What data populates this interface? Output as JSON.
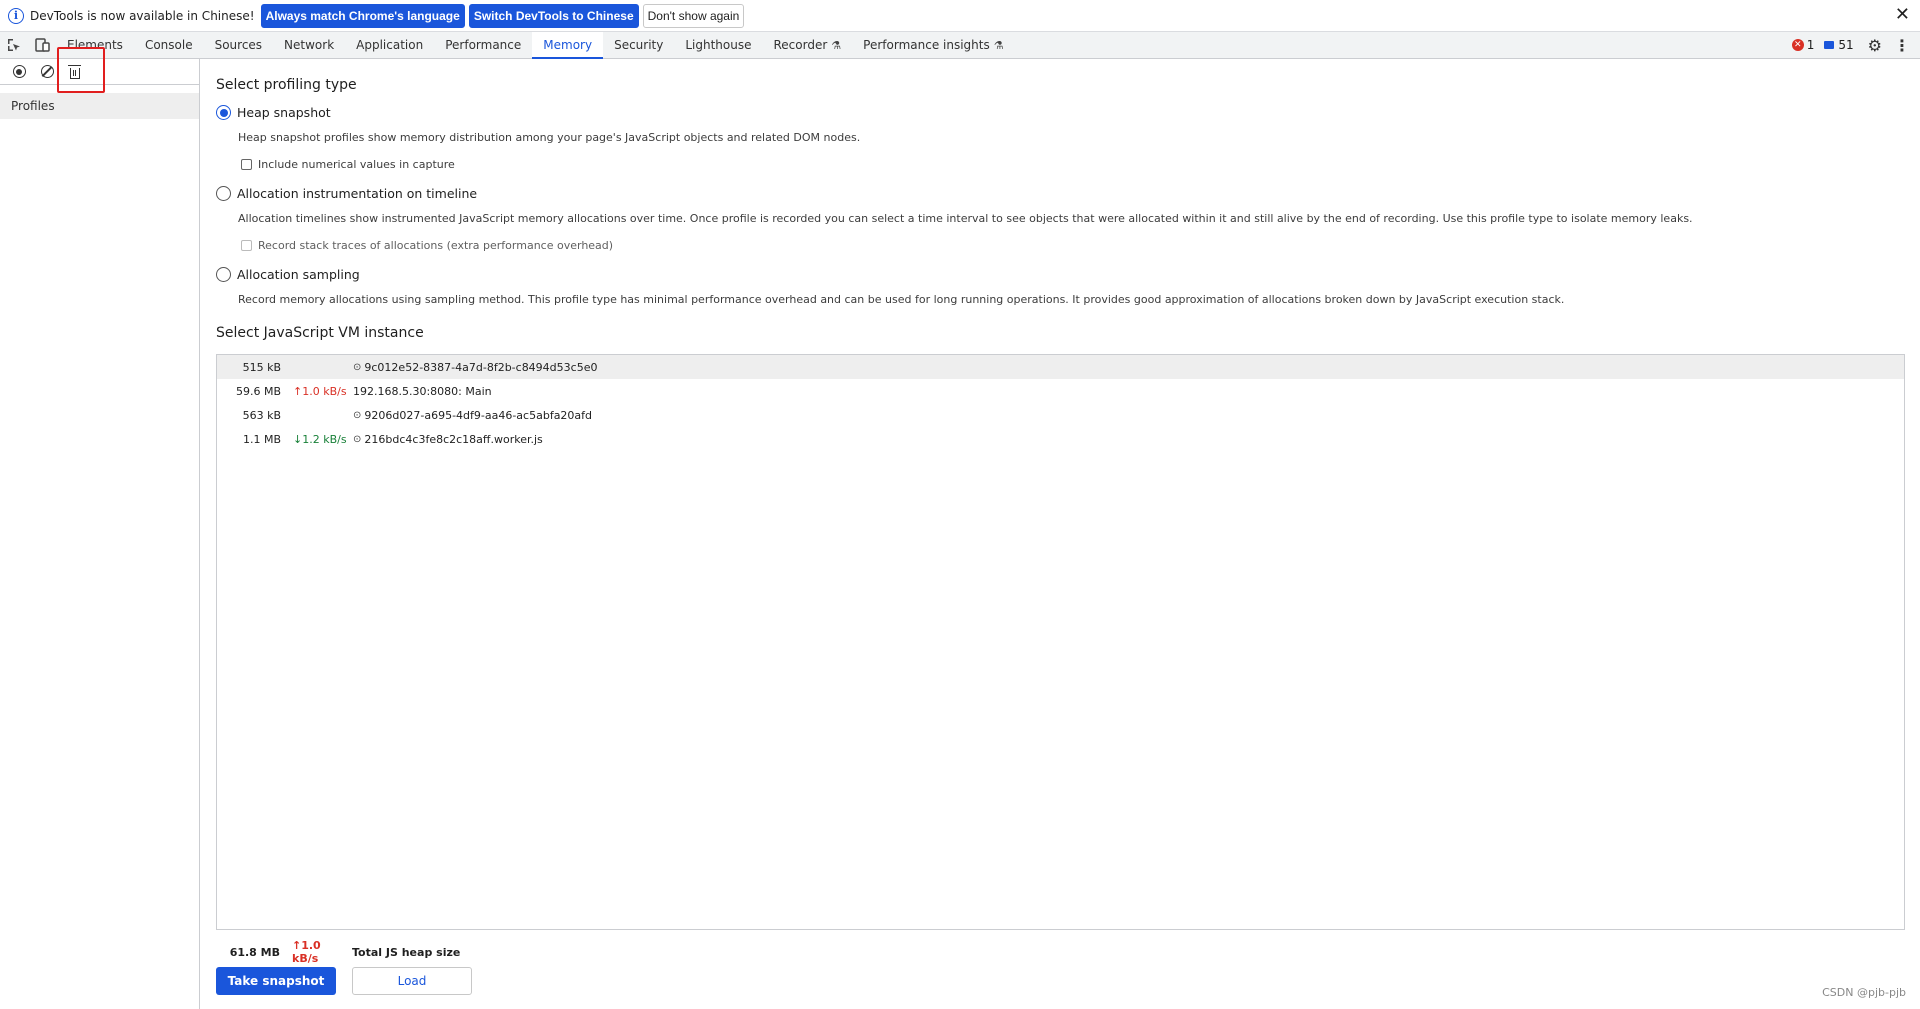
{
  "infobar": {
    "message": "DevTools is now available in Chinese!",
    "btn_match": "Always match Chrome's language",
    "btn_switch": "Switch DevTools to Chinese",
    "btn_dismiss": "Don't show again",
    "close_glyph": "✕"
  },
  "tabs": [
    {
      "label": "Elements"
    },
    {
      "label": "Console"
    },
    {
      "label": "Sources"
    },
    {
      "label": "Network"
    },
    {
      "label": "Application"
    },
    {
      "label": "Performance"
    },
    {
      "label": "Memory"
    },
    {
      "label": "Security"
    },
    {
      "label": "Lighthouse"
    },
    {
      "label": "Recorder"
    },
    {
      "label": "Performance insights"
    }
  ],
  "status": {
    "errors": "1",
    "messages": "51"
  },
  "sidebar": {
    "section_label": "Profiles"
  },
  "profiling": {
    "title": "Select profiling type",
    "options": [
      {
        "label": "Heap snapshot",
        "description": "Heap snapshot profiles show memory distribution among your page's JavaScript objects and related DOM nodes.",
        "checkbox_label": "Include numerical values in capture",
        "selected": true
      },
      {
        "label": "Allocation instrumentation on timeline",
        "description": "Allocation timelines show instrumented JavaScript memory allocations over time. Once profile is recorded you can select a time interval to see objects that were allocated within it and still alive by the end of recording. Use this profile type to isolate memory leaks.",
        "checkbox_label": "Record stack traces of allocations (extra performance overhead)",
        "selected": false
      },
      {
        "label": "Allocation sampling",
        "description": "Record memory allocations using sampling method. This profile type has minimal performance overhead and can be used for long running operations. It provides good approximation of allocations broken down by JavaScript execution stack.",
        "selected": false
      }
    ]
  },
  "vm": {
    "title": "Select JavaScript VM instance",
    "rows": [
      {
        "size": "515 kB",
        "rate": "",
        "name": "9c012e52-8387-4a7d-8f2b-c8494d53c5e0"
      },
      {
        "size": "59.6 MB",
        "rate": "↑1.0 kB/s",
        "name": "192.168.5.30:8080: Main"
      },
      {
        "size": "563 kB",
        "rate": "",
        "name": "9206d027-a695-4df9-aa46-ac5abfa20afd"
      },
      {
        "size": "1.1 MB",
        "rate": "↓1.2 kB/s",
        "name": "216bdc4c3fe8c2c18aff.worker.js"
      }
    ],
    "total_size": "61.8 MB",
    "total_rate": "↑1.0 kB/s",
    "total_label": "Total JS heap size"
  },
  "actions": {
    "take_snapshot": "Take snapshot",
    "load": "Load"
  },
  "watermark": "CSDN @pjb-pjb",
  "colors": {
    "accent": "#1a56db",
    "error": "#d93025",
    "success": "#188038",
    "highlight": "#e11e1e"
  }
}
